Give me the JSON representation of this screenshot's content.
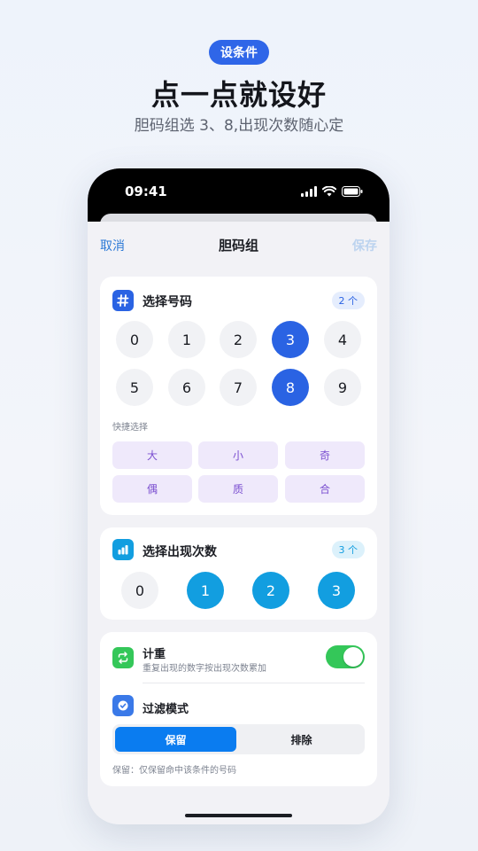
{
  "promo": {
    "badge": "设条件",
    "headline": "点一点就设好",
    "subline": "胆码组选 3、8,出现次数随心定"
  },
  "status_bar": {
    "time": "09:41"
  },
  "nav": {
    "cancel": "取消",
    "title": "胆码组",
    "save": "保存"
  },
  "select_numbers": {
    "title": "选择号码",
    "count_badge": "2 个",
    "numbers": [
      "0",
      "1",
      "2",
      "3",
      "4",
      "5",
      "6",
      "7",
      "8",
      "9"
    ],
    "selected": [
      "3",
      "8"
    ],
    "quick_label": "快捷选择",
    "quick_options": [
      "大",
      "小",
      "奇",
      "偶",
      "质",
      "合"
    ],
    "accent": "#2a63e3"
  },
  "select_occurrences": {
    "title": "选择出现次数",
    "count_badge": "3 个",
    "options": [
      "0",
      "1",
      "2",
      "3"
    ],
    "selected": [
      "1",
      "2",
      "3"
    ],
    "accent": "#129ee0"
  },
  "settings": {
    "weighting": {
      "title": "计重",
      "subtitle": "重复出现的数字按出现次数累加",
      "enabled": true,
      "accent": "#34c759"
    },
    "filter_mode": {
      "title": "过滤模式",
      "options": [
        "保留",
        "排除"
      ],
      "selected": "保留",
      "hint": "保留：仅保留命中该条件的号码"
    }
  }
}
